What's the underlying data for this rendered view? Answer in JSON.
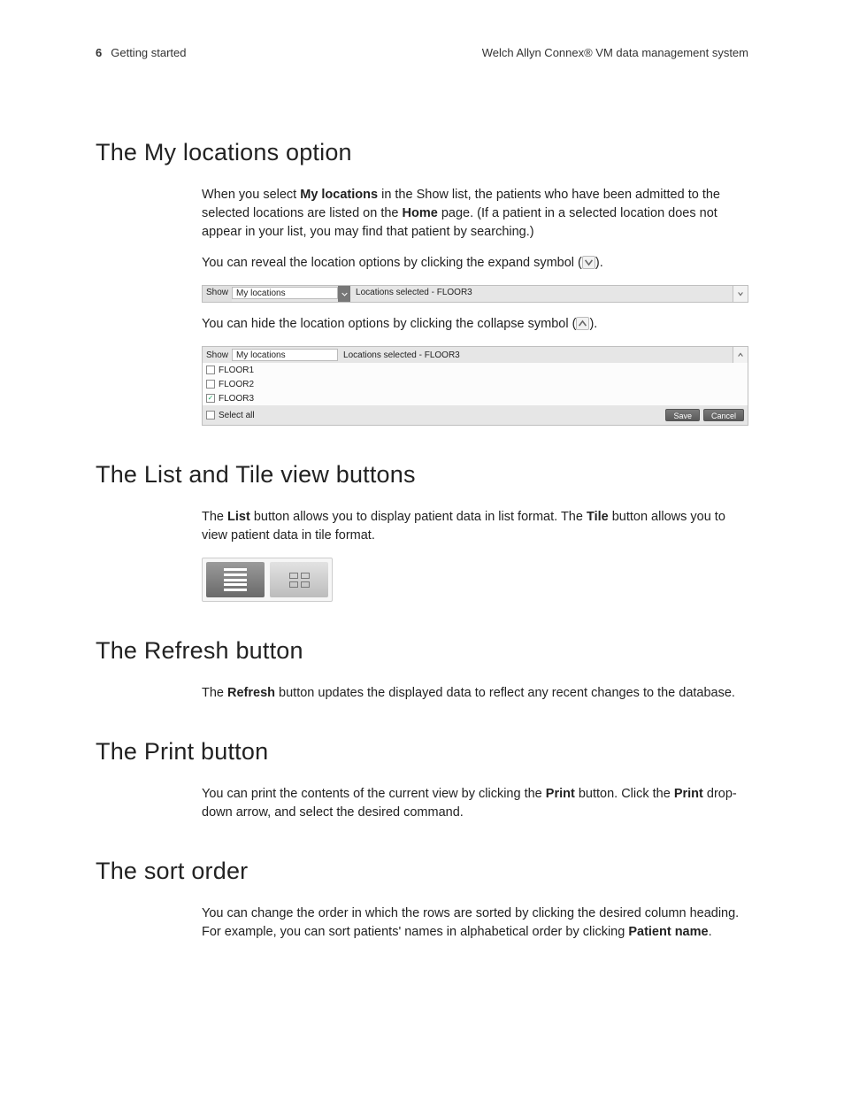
{
  "header": {
    "page_number": "6",
    "section": "Getting started",
    "product": "Welch Allyn Connex® VM data management system"
  },
  "s1": {
    "title": "The My locations option",
    "p1a": "When you select ",
    "p1b": "My locations",
    "p1c": " in the Show list, the patients who have been admitted to the selected locations are listed on the ",
    "p1d": "Home",
    "p1e": " page. (If a patient in a selected location does not appear in your list, you may find that patient by searching.)",
    "p2a": "You can reveal the location options by clicking the expand symbol (",
    "p2b": ").",
    "p3a": "You can hide the location options by clicking the collapse symbol (",
    "p3b": ")."
  },
  "locbar": {
    "show_label": "Show",
    "show_value": "My locations",
    "locations_selected": "Locations selected - FLOOR3"
  },
  "panel": {
    "show_label": "Show",
    "show_value": "My locations",
    "locations_selected": "Locations selected - FLOOR3",
    "floors": [
      "FLOOR1",
      "FLOOR2",
      "FLOOR3"
    ],
    "checked_index": 2,
    "select_all": "Select all",
    "save": "Save",
    "cancel": "Cancel"
  },
  "s2": {
    "title": "The List and Tile view buttons",
    "p1a": "The ",
    "p1b": "List",
    "p1c": " button allows you to display patient data in list format. The ",
    "p1d": "Tile",
    "p1e": " button allows you to view patient data in tile format."
  },
  "s3": {
    "title": "The Refresh button",
    "p1a": "The ",
    "p1b": "Refresh",
    "p1c": " button updates the displayed data to reflect any recent changes to the database."
  },
  "s4": {
    "title": "The Print button",
    "p1a": "You can print the contents of the current view by clicking the ",
    "p1b": "Print",
    "p1c": " button. Click the ",
    "p1d": "Print",
    "p1e": " drop-down arrow, and select the desired command."
  },
  "s5": {
    "title": "The sort order",
    "p1a": "You can change the order in which the rows are sorted by clicking the desired column heading. For example, you can sort patients' names in alphabetical order by clicking ",
    "p1b": "Patient name",
    "p1c": "."
  }
}
